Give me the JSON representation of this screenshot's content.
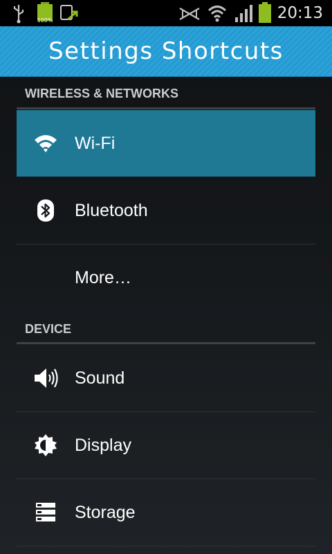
{
  "status_bar": {
    "time": "20:13",
    "battery_label": "100%",
    "icons": [
      "usb-icon",
      "battery-full-icon",
      "screen-mirror-icon",
      "sound-mute-icon",
      "wifi-status-icon",
      "signal-icon",
      "battery-icon"
    ]
  },
  "title_bar": {
    "title": "Settings Shortcuts",
    "accent_color": "#2aa3da"
  },
  "sections": [
    {
      "header": "WIRELESS & NETWORKS",
      "items": [
        {
          "label": "Wi-Fi",
          "icon": "wifi-icon",
          "selected": true
        },
        {
          "label": "Bluetooth",
          "icon": "bluetooth-icon",
          "selected": false
        },
        {
          "label": "More…",
          "icon": "",
          "selected": false
        }
      ]
    },
    {
      "header": "DEVICE",
      "items": [
        {
          "label": "Sound",
          "icon": "speaker-icon",
          "selected": false
        },
        {
          "label": "Display",
          "icon": "brightness-icon",
          "selected": false
        },
        {
          "label": "Storage",
          "icon": "storage-icon",
          "selected": false
        }
      ]
    }
  ],
  "colors": {
    "selected_row": "#1f7894",
    "background": "#15181b"
  }
}
